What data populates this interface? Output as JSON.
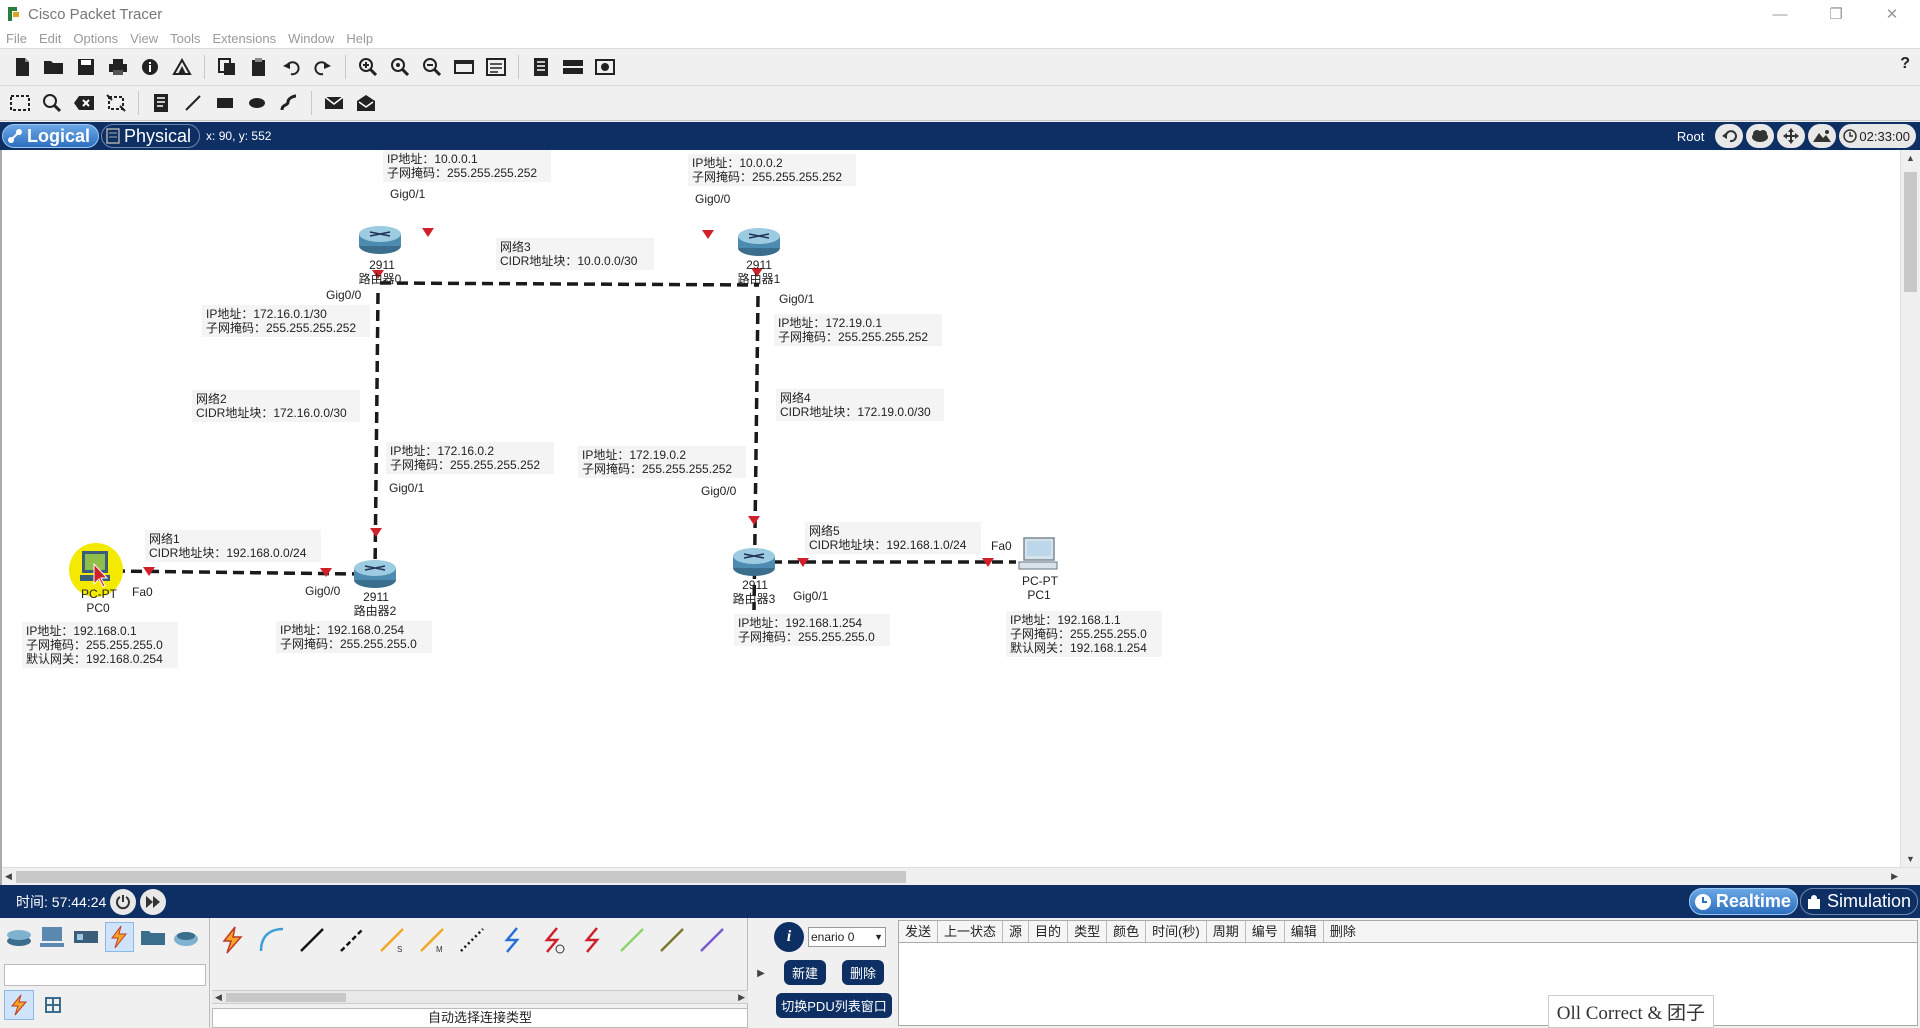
{
  "window": {
    "title": "Cisco Packet Tracer",
    "min": "—",
    "restore": "❐",
    "close": "✕"
  },
  "menu": [
    "File",
    "Edit",
    "Options",
    "View",
    "Tools",
    "Extensions",
    "Window",
    "Help"
  ],
  "workspace": {
    "tabs": {
      "logical": "Logical",
      "physical": "Physical"
    },
    "coords": "x: 90, y: 552",
    "root": "Root",
    "clock": "02:33:00"
  },
  "topology": {
    "devices": [
      {
        "id": "r0",
        "model": "2911",
        "name": "路由器0",
        "type": "router"
      },
      {
        "id": "r1",
        "model": "2911",
        "name": "路由器1",
        "type": "router"
      },
      {
        "id": "r2",
        "model": "2911",
        "name": "路由器2",
        "type": "router"
      },
      {
        "id": "r3",
        "model": "2911",
        "name": "路由器3",
        "type": "router"
      },
      {
        "id": "pc0",
        "model": "PC-PT",
        "name": "PC0",
        "type": "pc"
      },
      {
        "id": "pc1",
        "model": "PC-PT",
        "name": "PC1",
        "type": "pc"
      }
    ],
    "ports": {
      "r0_g01": "Gig0/1",
      "r0_g00": "Gig0/0",
      "r1_g00": "Gig0/0",
      "r1_g01": "Gig0/1",
      "r2_g01": "Gig0/1",
      "r2_g00": "Gig0/0",
      "r3_g00": "Gig0/0",
      "r3_g01": "Gig0/1",
      "pc0_fa0": "Fa0",
      "pc1_fa0": "Fa0"
    },
    "notes": {
      "r0_top": [
        "IP地址：10.0.0.1",
        "子网掩码：255.255.255.252"
      ],
      "r1_top": [
        "IP地址：10.0.0.2",
        "子网掩码：255.255.255.252"
      ],
      "net3": [
        "网络3",
        "CIDR地址块：10.0.0.0/30"
      ],
      "r0_left": [
        "IP地址：172.16.0.1/30",
        "子网掩码：255.255.255.252"
      ],
      "r1_right": [
        "IP地址：172.19.0.1",
        "子网掩码：255.255.255.252"
      ],
      "net2": [
        "网络2",
        "CIDR地址块：172.16.0.0/30"
      ],
      "net4": [
        "网络4",
        "CIDR地址块：172.19.0.0/30"
      ],
      "r2_top": [
        "IP地址：172.16.0.2",
        "子网掩码：255.255.255.252"
      ],
      "r3_top": [
        "IP地址：172.19.0.2",
        "子网掩码：255.255.255.252"
      ],
      "net1": [
        "网络1",
        "CIDR地址块：192.168.0.0/24"
      ],
      "net5": [
        "网络5",
        "CIDR地址块：192.168.1.0/24"
      ],
      "pc0": [
        "IP地址：192.168.0.1",
        "子网掩码：255.255.255.0",
        "默认网关：192.168.0.254"
      ],
      "r2_bottom": [
        "IP地址：192.168.0.254",
        "子网掩码：255.255.255.0"
      ],
      "r3_bottom": [
        "IP地址：192.168.1.254",
        "子网掩码：255.255.255.0"
      ],
      "pc1": [
        "IP地址：192.168.1.1",
        "子网掩码：255.255.255.0",
        "默认网关：192.168.1.254"
      ]
    },
    "colors": {
      "link": "#1a1a1a",
      "port_marker": "#d0202a",
      "highlight": "#f4e900"
    }
  },
  "status": {
    "time": "时间: 57:44:24",
    "realtime": "Realtime",
    "simulation": "Simulation"
  },
  "bottom": {
    "connection_label": "自动选择连接类型",
    "scenario": "enario 0",
    "new_btn": "新建",
    "delete_btn": "删除",
    "toggle_btn": "切换PDU列表窗口",
    "pdu_columns": [
      "发送",
      "上一状态",
      "源",
      "目的",
      "类型",
      "颜色",
      "时间(秒)",
      "周期",
      "编号",
      "编辑",
      "删除"
    ],
    "watermark": "Oll Correct & 团子"
  }
}
